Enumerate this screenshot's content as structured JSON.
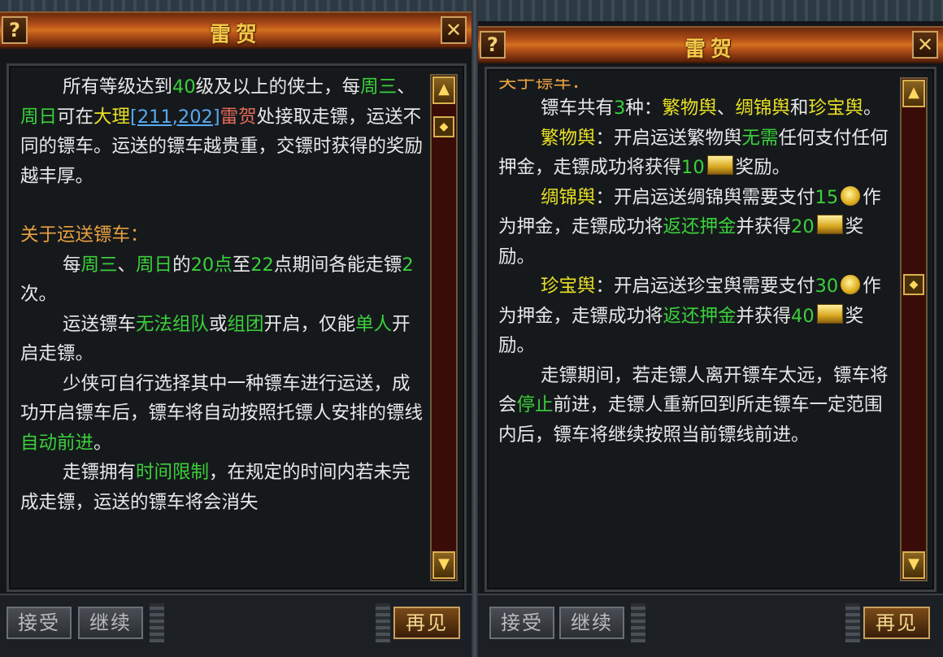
{
  "left_panel": {
    "title": "雷贺",
    "help_label": "?",
    "close_label": "✕",
    "intro": {
      "t1": "所有等级达到",
      "level": "40",
      "t2": "级及以上的侠士，每",
      "day1": "周三",
      "t3": "、",
      "day2": "周日",
      "t4": "可在",
      "place": "大理",
      "coords": "[211,202]",
      "npc": "雷贺",
      "t5": "处接取走镖，运送不同的镖车。运送的镖车越贵重，交镖时获得的奖励越丰厚。"
    },
    "section_heading": "关于运送镖车：",
    "para1": {
      "t1": "每",
      "day1": "周三",
      "t2": "、",
      "day2": "周日",
      "t3": "的",
      "start": "20点",
      "t4": "至",
      "end": "22",
      "t5": "点期间各能走镖",
      "count": "2",
      "t6": "次。"
    },
    "para2": {
      "t1": "运送镖车",
      "cannot_team": "无法组队",
      "t2": "或",
      "group": "组团",
      "t3": "开启，仅能",
      "solo": "单人",
      "t4": "开启走镖。"
    },
    "para3": {
      "t1": "少侠可自行选择其中一种镖车进行运送，成功开启镖车后，镖车将自动按照托镖人安排的镖线",
      "auto": "自动前进",
      "t2": "。"
    },
    "para4": {
      "t1": "走镖拥有",
      "limit": "时间限制",
      "t2": "，在规定的时间内若未完成走镖，运送的镖车将会消失"
    },
    "buttons": {
      "accept": "接受",
      "continue": "继续",
      "goodbye": "再见"
    }
  },
  "right_panel": {
    "title": "雷贺",
    "help_label": "?",
    "close_label": "✕",
    "section_heading": "关于镖车：",
    "intro": {
      "t1": "镖车共有",
      "count": "3",
      "t2": "种：",
      "cart1": "繁物舆",
      "t3": "、",
      "cart2": "绸锦舆",
      "t4": "和",
      "cart3": "珍宝舆",
      "t5": "。"
    },
    "cart1_para": {
      "name": "繁物舆",
      "t1": "：开启运送繁物舆",
      "free": "无需",
      "t2": "任何支付任何押金，走镖成功将获得",
      "reward": "10",
      "t3": "奖励。"
    },
    "cart2_para": {
      "name": "绸锦舆",
      "t1": "：开启运送绸锦舆需要支付",
      "deposit": "15",
      "t2": "作为押金，走镖成功将",
      "refund": "返还押金",
      "t3": "并获得",
      "reward": "20",
      "t4": "奖励。"
    },
    "cart3_para": {
      "name": "珍宝舆",
      "t1": "：开启运送珍宝舆需要支付",
      "deposit": "30",
      "t2": "作为押金，走镖成功将",
      "refund": "返还押金",
      "t3": "并获得",
      "reward": "40",
      "t4": "奖励。"
    },
    "note": {
      "t1": "走镖期间，若走镖人离开镖车太远，镖车将会",
      "stop": "停止",
      "t2": "前进，走镖人重新回到所走镖车一定范围内后，镖车将继续按照当前镖线前进。"
    },
    "buttons": {
      "accept": "接受",
      "continue": "继续",
      "goodbye": "再见"
    }
  },
  "icons": {
    "coin": "copper-coin-icon",
    "ingot": "gold-ingot-icon",
    "scroll_up": "▲",
    "scroll_down": "▼",
    "scroll_thumb": "◆"
  },
  "colors": {
    "highlight_yellow": "#e8e024",
    "highlight_green": "#3ad03a",
    "heading_orange": "#e8a040",
    "npc_red": "#e46a5a",
    "link_blue": "#58a8f0",
    "title_gold": "#f2c84a"
  }
}
